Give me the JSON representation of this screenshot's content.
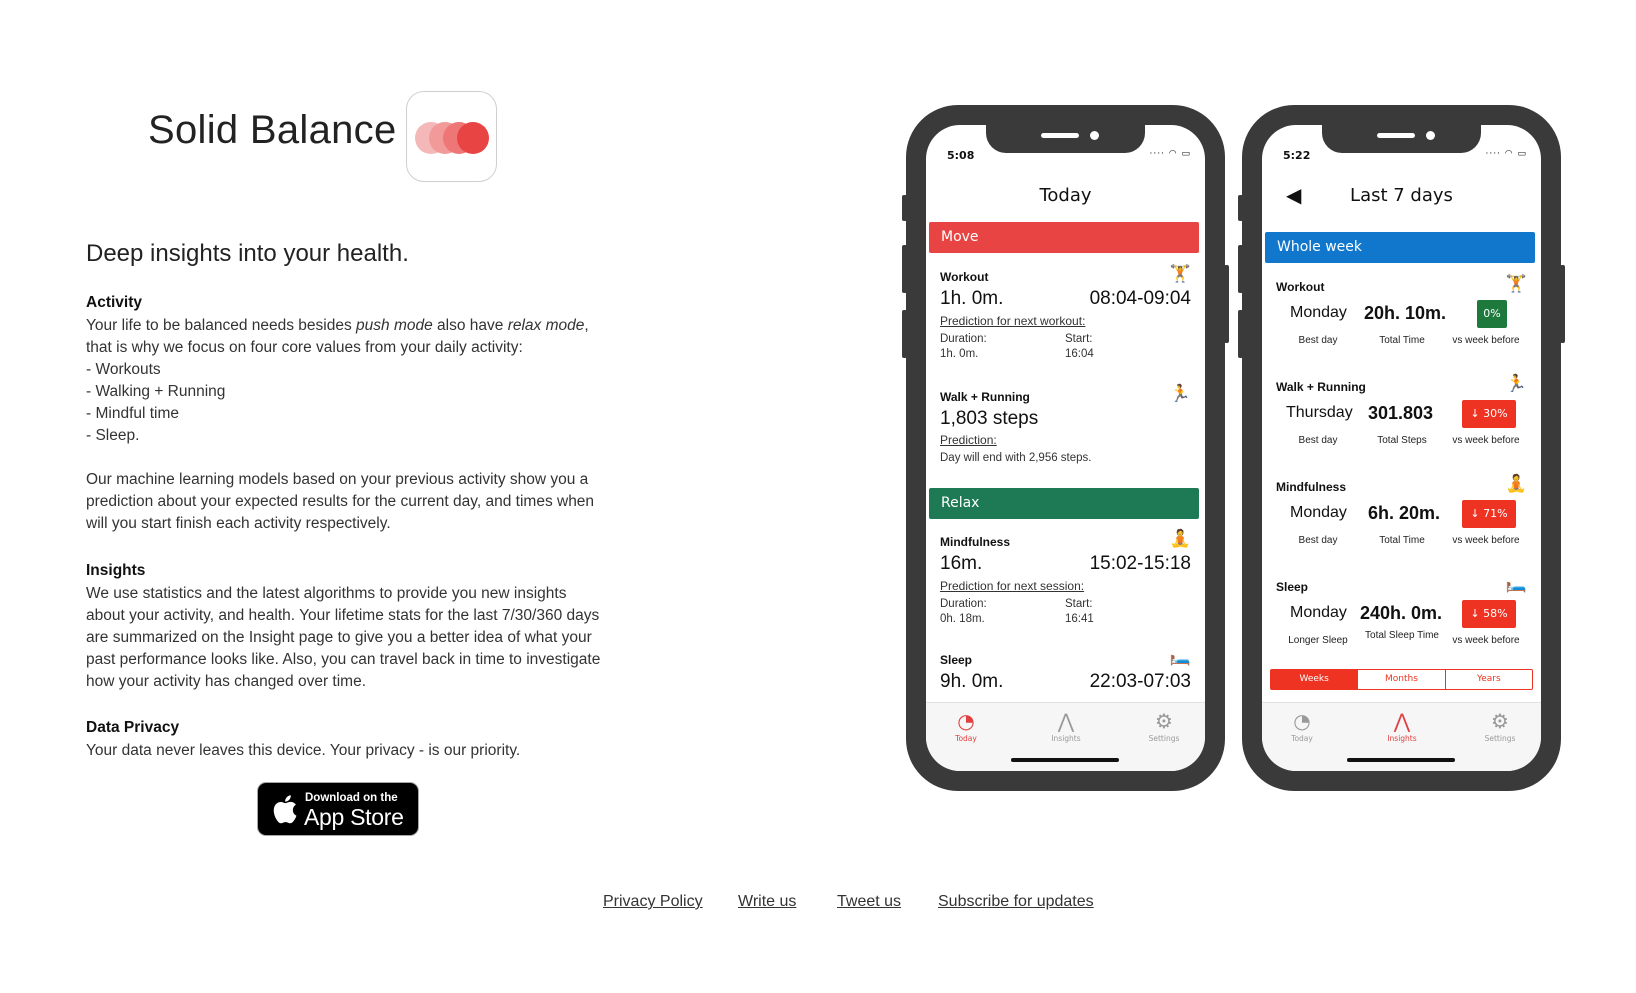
{
  "header": {
    "title": "Solid Balance",
    "icon_name": "app-logo-circles-icon"
  },
  "tagline": "Deep insights into your health.",
  "sections": {
    "activity": {
      "title": "Activity",
      "intro_before_push": "Your life to be balanced needs besides ",
      "push_mode": "push mode",
      "between": " also have ",
      "relax_mode": "relax mode",
      "after_relax": ",",
      "rest": "that is why we focus on four core values from your daily activity:",
      "list": [
        "- Workouts",
        "- Walking + Running",
        "- Mindful time",
        "- Sleep."
      ],
      "ml_paragraph": "Our machine learning models based on your previous activity show you a prediction about your expected results for the current day, and times when will you start finish each activity respectively."
    },
    "insights": {
      "title": "Insights",
      "body": "We use statistics and the latest algorithms to provide you new insights about your activity, and health. Your lifetime stats for the last 7/30/360 days are summarized on the Insight page to give you a better idea of what your past performance looks like. Also, you can travel back in time to investigate how your activity has changed over time."
    },
    "privacy": {
      "title": "Data Privacy",
      "body": "Your data never leaves this device. Your privacy - is our priority."
    }
  },
  "appstore": {
    "small": "Download on the",
    "big": "App Store"
  },
  "footer": {
    "links": [
      "Privacy Policy",
      "Write us",
      "Tweet us",
      "Subscribe for updates"
    ]
  },
  "colors": {
    "move": "#e84444",
    "relax": "#1e7a55",
    "whole_week": "#1177cc",
    "badge_green": "#1e7a3c",
    "badge_red": "#ee3322",
    "accent": "#e04040"
  },
  "phone_today": {
    "status_time": "5:08",
    "title": "Today",
    "move_label": "Move",
    "relax_label": "Relax",
    "workout": {
      "label": "Workout",
      "emoji": "🏋️",
      "value": "1h. 0m.",
      "range": "08:04-09:04",
      "prediction": "Prediction for next workout:",
      "duration_label": "Duration:",
      "duration": "1h. 0m.",
      "start_label": "Start:",
      "start": "16:04"
    },
    "walk": {
      "label": "Walk + Running",
      "emoji": "🏃",
      "value": "1,803 steps",
      "prediction": "Prediction:",
      "note": "Day will end with 2,956 steps."
    },
    "mindfulness": {
      "label": "Mindfulness",
      "emoji": "🧘",
      "value": "16m.",
      "range": "15:02-15:18",
      "prediction": "Prediction for next session:",
      "duration_label": "Duration:",
      "duration": "0h. 18m.",
      "start_label": "Start:",
      "start": "16:41"
    },
    "sleep": {
      "label": "Sleep",
      "emoji": "🛏️",
      "value": "9h. 0m.",
      "range": "22:03-07:03"
    }
  },
  "phone_insights": {
    "status_time": "5:22",
    "title": "Last 7 days",
    "band": "Whole week",
    "items": [
      {
        "label": "Workout",
        "emoji": "🏋️",
        "day": "Monday",
        "value": "20h. 10m.",
        "badge": "0%",
        "badge_color": "green",
        "sub1": "Best day",
        "sub2": "Total Time",
        "sub3": "vs week before"
      },
      {
        "label": "Walk + Running",
        "emoji": "🏃",
        "day": "Thursday",
        "value": "301.803",
        "badge": "↓ 30%",
        "badge_color": "red",
        "sub1": "Best day",
        "sub2": "Total Steps",
        "sub3": "vs week before"
      },
      {
        "label": "Mindfulness",
        "emoji": "🧘",
        "day": "Monday",
        "value": "6h. 20m.",
        "badge": "↓ 71%",
        "badge_color": "red",
        "sub1": "Best day",
        "sub2": "Total Time",
        "sub3": "vs week before"
      },
      {
        "label": "Sleep",
        "emoji": "🛏️",
        "day": "Monday",
        "value": "240h. 0m.",
        "badge": "↓ 58%",
        "badge_color": "red",
        "sub1": "Longer Sleep",
        "sub2": "Total Sleep Time",
        "sub3": "vs week before"
      }
    ],
    "segments": [
      "Weeks",
      "Months",
      "Years"
    ],
    "active_segment": "Weeks"
  },
  "tabs": [
    "Today",
    "Insights",
    "Settings"
  ]
}
